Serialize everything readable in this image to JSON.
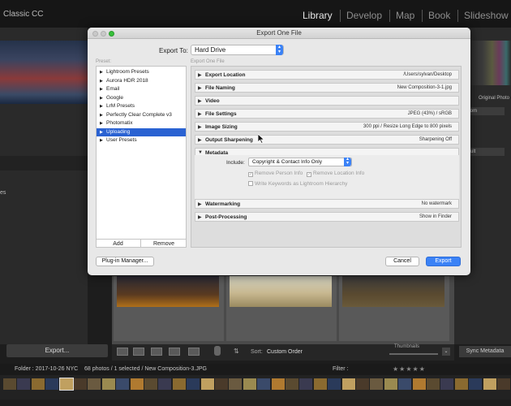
{
  "app": {
    "title": "Classic CC",
    "modules": [
      "Library",
      "Develop",
      "Map",
      "Book",
      "Slideshow"
    ],
    "active_module": "Library"
  },
  "left_panel": {
    "partial_label": "es",
    "export_button": "Export..."
  },
  "right_panel": {
    "original_photo_label": "Original Photo",
    "preset_select_partial": "stom",
    "default_select_partial": "fault",
    "sync_metadata_button": "Sync Metadata"
  },
  "toolbar": {
    "sort_label": "Sort:",
    "sort_value": "Custom Order",
    "thumbnails_label": "Thumbnails"
  },
  "info_bar": {
    "folder": "Folder : 2017-10-26 NYC",
    "photos": "68 photos / 1 selected / New Composition-3.JPG",
    "filter_label": "Filter :"
  },
  "dialog": {
    "title": "Export One File",
    "export_to_label": "Export To:",
    "export_to_value": "Hard Drive",
    "preset_header": "Preset:",
    "section_header": "Export One File",
    "presets": [
      {
        "label": "Lightroom Presets",
        "selected": false
      },
      {
        "label": "Aurora HDR 2018",
        "selected": false
      },
      {
        "label": "Email",
        "selected": false
      },
      {
        "label": "Google",
        "selected": false
      },
      {
        "label": "LrM Presets",
        "selected": false
      },
      {
        "label": "Perfectly Clear Complete v3",
        "selected": false
      },
      {
        "label": "Photomatix",
        "selected": false
      },
      {
        "label": "Uploading",
        "selected": true
      },
      {
        "label": "User Presets",
        "selected": false
      }
    ],
    "preset_add": "Add",
    "preset_remove": "Remove",
    "sections": [
      {
        "title": "Export Location",
        "summary": "/Users/sylvan/Desktop",
        "expanded": false
      },
      {
        "title": "File Naming",
        "summary": "New Composition-3-1.jpg",
        "expanded": false
      },
      {
        "title": "Video",
        "summary": "",
        "expanded": false
      },
      {
        "title": "File Settings",
        "summary": "JPEG (43%) / sRGB",
        "expanded": false
      },
      {
        "title": "Image Sizing",
        "summary": "300 ppi / Resize Long Edge to 800 pixels",
        "expanded": false
      },
      {
        "title": "Output Sharpening",
        "summary": "Sharpening Off",
        "expanded": false
      },
      {
        "title": "Metadata",
        "summary": "",
        "expanded": true
      },
      {
        "title": "Watermarking",
        "summary": "No watermark",
        "expanded": false
      },
      {
        "title": "Post-Processing",
        "summary": "Show in Finder",
        "expanded": false
      }
    ],
    "metadata": {
      "include_label": "Include:",
      "include_value": "Copyright & Contact Info Only",
      "remove_person_info": "Remove Person Info",
      "remove_location_info": "Remove Location Info",
      "write_keywords": "Write Keywords as Lightroom Hierarchy"
    },
    "plugin_manager_button": "Plug-in Manager...",
    "cancel_button": "Cancel",
    "export_button": "Export"
  }
}
